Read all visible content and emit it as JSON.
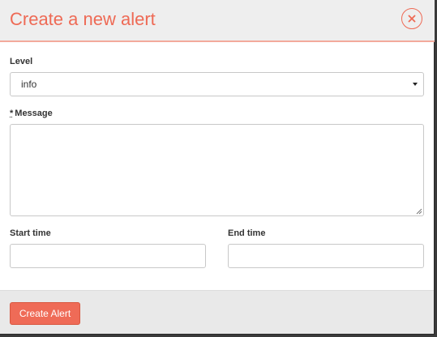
{
  "modal": {
    "title": "Create a new alert",
    "close_icon": "close-icon"
  },
  "form": {
    "level": {
      "label": "Level",
      "value": "info"
    },
    "message": {
      "required_marker": "*",
      "label": "Message",
      "value": ""
    },
    "start_time": {
      "label": "Start time",
      "value": ""
    },
    "end_time": {
      "label": "End time",
      "value": ""
    }
  },
  "footer": {
    "submit_label": "Create Alert"
  },
  "colors": {
    "accent": "#ee6a55",
    "button": "#ef6b57",
    "header_bg": "#eeeeee",
    "footer_bg": "#e9e9e9"
  }
}
